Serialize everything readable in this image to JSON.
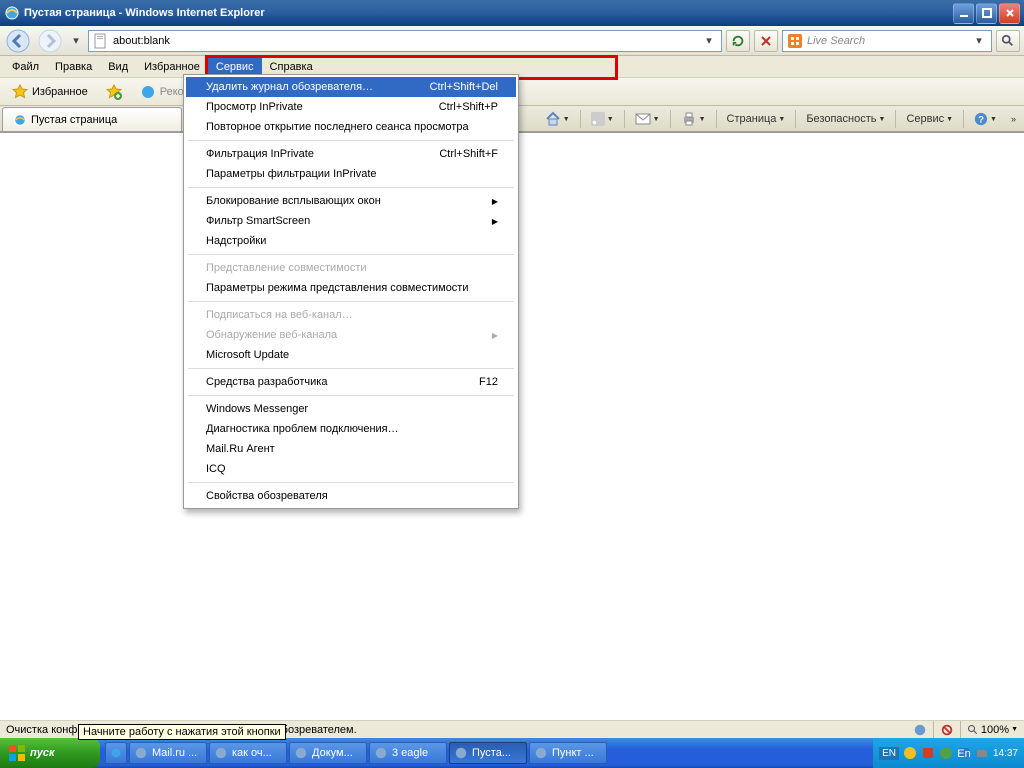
{
  "window": {
    "title": "Пустая страница - Windows Internet Explorer"
  },
  "address": {
    "url": "about:blank"
  },
  "search": {
    "placeholder": "Live Search"
  },
  "menu": {
    "items": [
      "Файл",
      "Правка",
      "Вид",
      "Избранное",
      "Сервис",
      "Справка"
    ],
    "active_index": 4
  },
  "favbar": {
    "fav_label": "Избранное",
    "rec_label": "Рекомен..."
  },
  "tab": {
    "title": "Пустая страница"
  },
  "commandbar": {
    "page": "Страница",
    "safety": "Безопасность",
    "tools": "Сервис"
  },
  "dropdown": [
    {
      "label": "Удалить журнал обозревателя…",
      "shortcut": "Ctrl+Shift+Del",
      "selected": true
    },
    {
      "label": "Просмотр InPrivate",
      "shortcut": "Ctrl+Shift+P"
    },
    {
      "label": "Повторное открытие последнего сеанса просмотра"
    },
    {
      "sep": true
    },
    {
      "label": "Фильтрация InPrivate",
      "shortcut": "Ctrl+Shift+F"
    },
    {
      "label": "Параметры фильтрации InPrivate"
    },
    {
      "sep": true
    },
    {
      "label": "Блокирование всплывающих окон",
      "submenu": true
    },
    {
      "label": "Фильтр SmartScreen",
      "submenu": true
    },
    {
      "label": "Надстройки"
    },
    {
      "sep": true
    },
    {
      "label": "Представление совместимости",
      "disabled": true
    },
    {
      "label": "Параметры режима представления совместимости"
    },
    {
      "sep": true
    },
    {
      "label": "Подписаться на веб-канал…",
      "disabled": true
    },
    {
      "label": "Обнаружение веб-канала",
      "disabled": true,
      "submenu": true
    },
    {
      "label": "Microsoft Update"
    },
    {
      "sep": true
    },
    {
      "label": "Средства разработчика",
      "shortcut": "F12"
    },
    {
      "sep": true
    },
    {
      "label": "Windows Messenger"
    },
    {
      "label": "Диагностика проблем подключения…"
    },
    {
      "label": "Mail.Ru Агент"
    },
    {
      "label": "ICQ"
    },
    {
      "sep": true
    },
    {
      "label": "Свойства обозревателя"
    }
  ],
  "status": {
    "text_left": "Очистка конфи",
    "text_right": "обозревателем.",
    "tooltip": "Начните работу с нажатия этой кнопки",
    "zoom": "100%"
  },
  "taskbar": {
    "start": "пуск",
    "items": [
      {
        "label": "Mail.ru ..."
      },
      {
        "label": "как оч..."
      },
      {
        "label": "Докум..."
      },
      {
        "label": "3 eagle"
      },
      {
        "label": "Пуста...",
        "active": true
      },
      {
        "label": "Пункт ..."
      }
    ],
    "lang": "EN",
    "clock": "14:37"
  }
}
